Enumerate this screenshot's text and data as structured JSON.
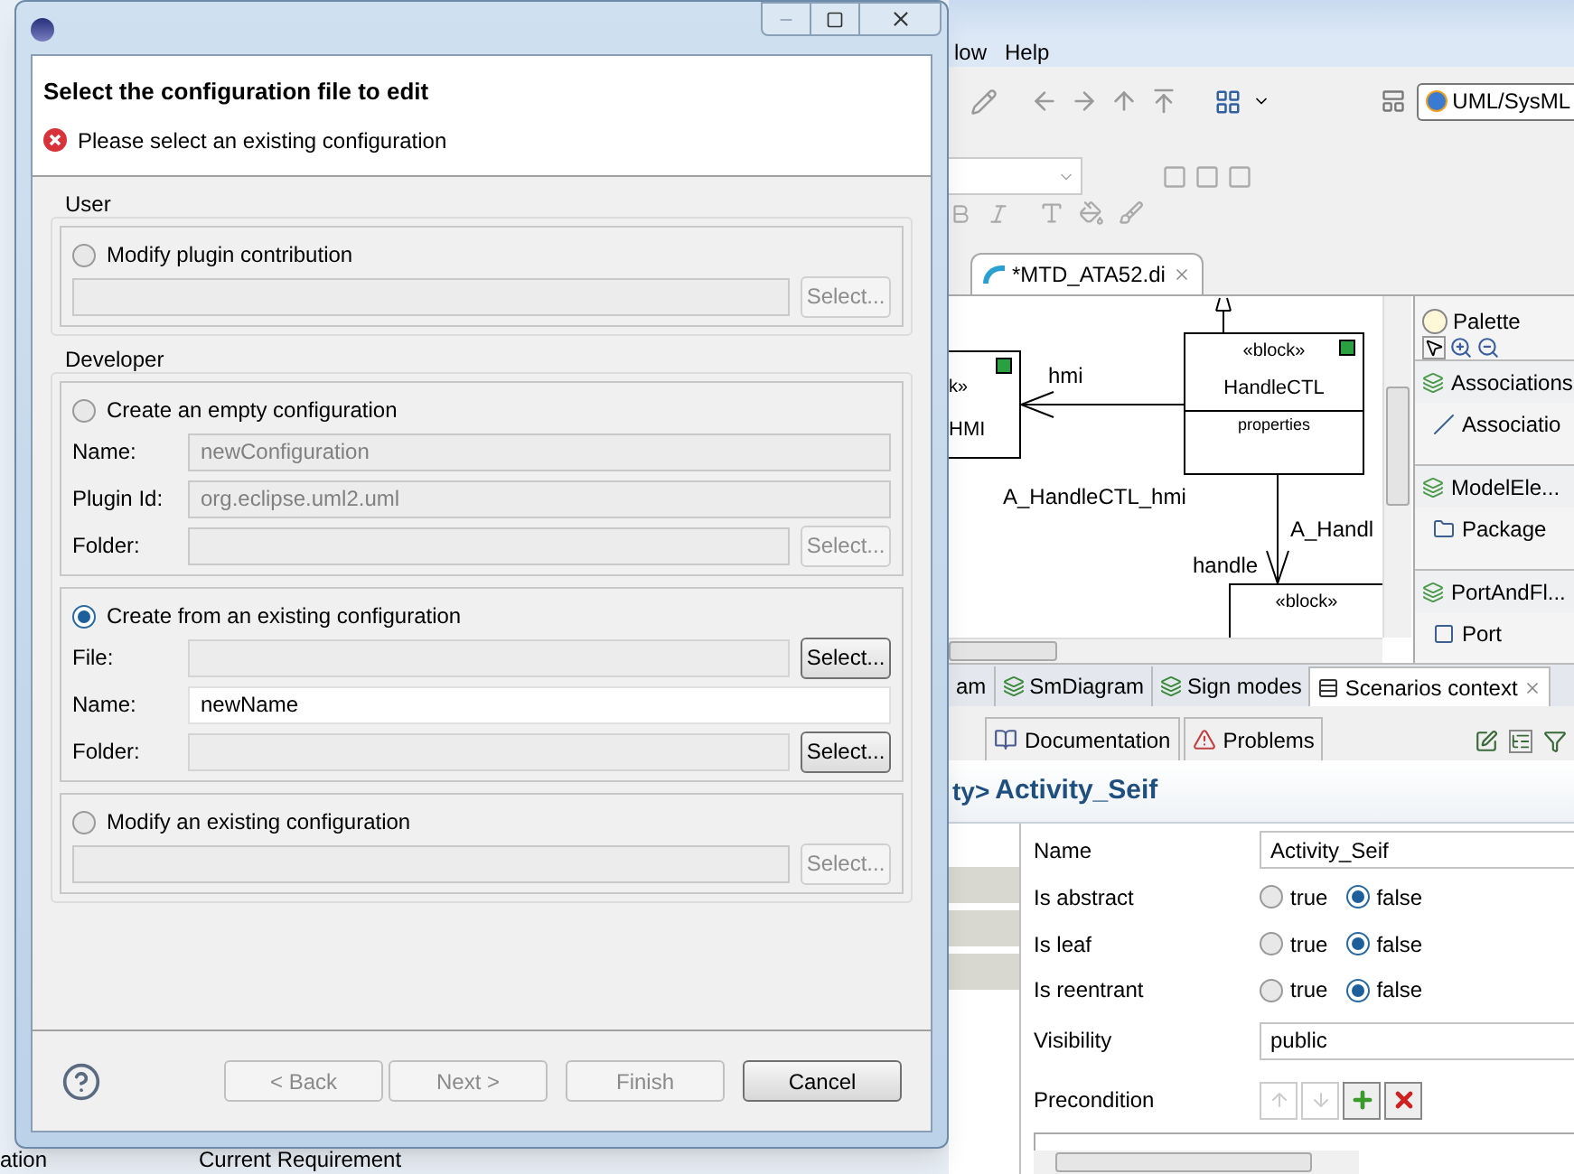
{
  "ide": {
    "menu": [
      "low",
      "Help"
    ],
    "perspective": "UML/SysML",
    "editor_tab": "*MTD_ATA52.di",
    "diagram": {
      "blocks": [
        {
          "kind": "left",
          "stereotype": "k»",
          "name": "HMI"
        },
        {
          "kind": "main",
          "stereotype": "«block»",
          "name": "HandleCTL",
          "compartment": "properties"
        },
        {
          "kind": "bottom",
          "stereotype": "«block»"
        }
      ],
      "labels": [
        {
          "kind": "role_left",
          "text": "hmi"
        },
        {
          "kind": "assoc_left",
          "text": "A_HandleCTL_hmi"
        },
        {
          "kind": "assoc_down",
          "text": "A_Handl"
        },
        {
          "kind": "role_down",
          "text": "handle"
        }
      ]
    },
    "palette": {
      "title": "Palette",
      "items": [
        {
          "kind": "drawer",
          "label": "Associations"
        },
        {
          "kind": "line",
          "label": "Associatio"
        },
        {
          "kind": "drawer",
          "label": "ModelEle..."
        },
        {
          "kind": "folder",
          "label": "Package"
        },
        {
          "kind": "drawer",
          "label": "PortAndFl..."
        },
        {
          "kind": "square",
          "label": "Port"
        }
      ]
    },
    "view_tabs": [
      {
        "kind": "partial",
        "label": "am",
        "selected": false
      },
      {
        "kind": "diagram",
        "label": "SmDiagram",
        "selected": false
      },
      {
        "kind": "diagram",
        "label": "Sign modes",
        "selected": false
      },
      {
        "kind": "context",
        "label": "Scenarios context",
        "selected": true
      }
    ],
    "bottom_tabs": [
      {
        "kind": "book",
        "label": "Documentation"
      },
      {
        "kind": "problems",
        "label": "Problems"
      }
    ],
    "properties": {
      "prefix": "ty>",
      "name": "Activity_Seif",
      "rows": [
        {
          "kind": "text",
          "label": "Name",
          "value": "Activity_Seif"
        },
        {
          "kind": "bool",
          "label": "Is abstract",
          "options": [
            {
              "label": "true",
              "selected": false
            },
            {
              "label": "false",
              "selected": true
            }
          ]
        },
        {
          "kind": "bool",
          "label": "Is leaf",
          "options": [
            {
              "label": "true",
              "selected": false
            },
            {
              "label": "false",
              "selected": true
            }
          ]
        },
        {
          "kind": "bool",
          "label": "Is reentrant",
          "options": [
            {
              "label": "true",
              "selected": false
            },
            {
              "label": "false",
              "selected": true
            }
          ]
        },
        {
          "kind": "combo",
          "label": "Visibility",
          "value": "public"
        },
        {
          "kind": "list",
          "label": "Precondition"
        }
      ]
    },
    "left_bottom": {
      "view": "ation",
      "tab": "Current Requirement"
    }
  },
  "dialog": {
    "title": "Select the configuration file to edit",
    "message": "Please select an existing configuration",
    "groups": [
      {
        "label": "User",
        "options": [
          {
            "label": "Modify plugin contribution",
            "selected": false,
            "fields": [
              {
                "kind": "picker",
                "button": "Select...",
                "disabled": true
              }
            ]
          }
        ]
      },
      {
        "label": "Developer",
        "options": [
          {
            "label": "Create an empty configuration",
            "selected": false,
            "fields": [
              {
                "kind": "text",
                "label": "Name:",
                "value": "newConfiguration",
                "disabled": true
              },
              {
                "kind": "text",
                "label": "Plugin Id:",
                "value": "org.eclipse.uml2.uml",
                "disabled": true
              },
              {
                "kind": "picker",
                "label": "Folder:",
                "button": "Select...",
                "disabled": true
              }
            ]
          },
          {
            "label": "Create from an existing configuration",
            "selected": true,
            "fields": [
              {
                "kind": "picker",
                "label": "File:",
                "button": "Select...",
                "disabled": false
              },
              {
                "kind": "text",
                "label": "Name:",
                "value": "newName",
                "disabled": false
              },
              {
                "kind": "picker",
                "label": "Folder:",
                "button": "Select...",
                "disabled": false
              }
            ]
          },
          {
            "label": "Modify an existing configuration",
            "selected": false,
            "fields": [
              {
                "kind": "picker",
                "button": "Select...",
                "disabled": true
              }
            ]
          }
        ]
      }
    ],
    "buttons": [
      {
        "label": "< Back",
        "disabled": true
      },
      {
        "label": "Next >",
        "disabled": true
      },
      {
        "label": "Finish",
        "disabled": true
      },
      {
        "label": "Cancel",
        "disabled": false
      }
    ]
  }
}
